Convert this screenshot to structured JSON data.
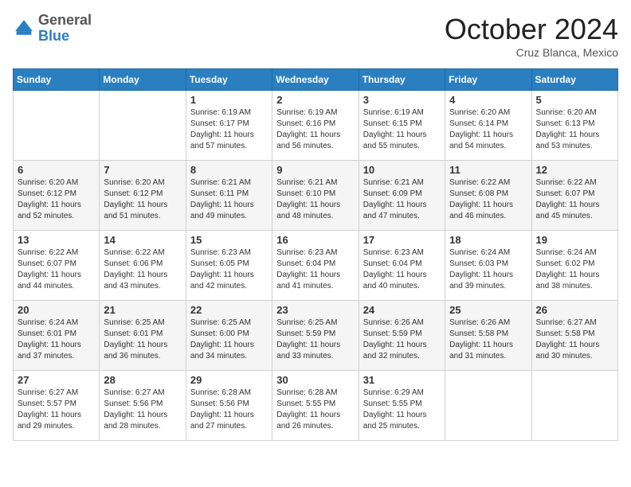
{
  "header": {
    "logo": {
      "general": "General",
      "blue": "Blue"
    },
    "title": "October 2024",
    "location": "Cruz Blanca, Mexico"
  },
  "days_of_week": [
    "Sunday",
    "Monday",
    "Tuesday",
    "Wednesday",
    "Thursday",
    "Friday",
    "Saturday"
  ],
  "weeks": [
    [
      null,
      null,
      {
        "num": "1",
        "sunrise": "Sunrise: 6:19 AM",
        "sunset": "Sunset: 6:17 PM",
        "daylight": "Daylight: 11 hours and 57 minutes."
      },
      {
        "num": "2",
        "sunrise": "Sunrise: 6:19 AM",
        "sunset": "Sunset: 6:16 PM",
        "daylight": "Daylight: 11 hours and 56 minutes."
      },
      {
        "num": "3",
        "sunrise": "Sunrise: 6:19 AM",
        "sunset": "Sunset: 6:15 PM",
        "daylight": "Daylight: 11 hours and 55 minutes."
      },
      {
        "num": "4",
        "sunrise": "Sunrise: 6:20 AM",
        "sunset": "Sunset: 6:14 PM",
        "daylight": "Daylight: 11 hours and 54 minutes."
      },
      {
        "num": "5",
        "sunrise": "Sunrise: 6:20 AM",
        "sunset": "Sunset: 6:13 PM",
        "daylight": "Daylight: 11 hours and 53 minutes."
      }
    ],
    [
      {
        "num": "6",
        "sunrise": "Sunrise: 6:20 AM",
        "sunset": "Sunset: 6:12 PM",
        "daylight": "Daylight: 11 hours and 52 minutes."
      },
      {
        "num": "7",
        "sunrise": "Sunrise: 6:20 AM",
        "sunset": "Sunset: 6:12 PM",
        "daylight": "Daylight: 11 hours and 51 minutes."
      },
      {
        "num": "8",
        "sunrise": "Sunrise: 6:21 AM",
        "sunset": "Sunset: 6:11 PM",
        "daylight": "Daylight: 11 hours and 49 minutes."
      },
      {
        "num": "9",
        "sunrise": "Sunrise: 6:21 AM",
        "sunset": "Sunset: 6:10 PM",
        "daylight": "Daylight: 11 hours and 48 minutes."
      },
      {
        "num": "10",
        "sunrise": "Sunrise: 6:21 AM",
        "sunset": "Sunset: 6:09 PM",
        "daylight": "Daylight: 11 hours and 47 minutes."
      },
      {
        "num": "11",
        "sunrise": "Sunrise: 6:22 AM",
        "sunset": "Sunset: 6:08 PM",
        "daylight": "Daylight: 11 hours and 46 minutes."
      },
      {
        "num": "12",
        "sunrise": "Sunrise: 6:22 AM",
        "sunset": "Sunset: 6:07 PM",
        "daylight": "Daylight: 11 hours and 45 minutes."
      }
    ],
    [
      {
        "num": "13",
        "sunrise": "Sunrise: 6:22 AM",
        "sunset": "Sunset: 6:07 PM",
        "daylight": "Daylight: 11 hours and 44 minutes."
      },
      {
        "num": "14",
        "sunrise": "Sunrise: 6:22 AM",
        "sunset": "Sunset: 6:06 PM",
        "daylight": "Daylight: 11 hours and 43 minutes."
      },
      {
        "num": "15",
        "sunrise": "Sunrise: 6:23 AM",
        "sunset": "Sunset: 6:05 PM",
        "daylight": "Daylight: 11 hours and 42 minutes."
      },
      {
        "num": "16",
        "sunrise": "Sunrise: 6:23 AM",
        "sunset": "Sunset: 6:04 PM",
        "daylight": "Daylight: 11 hours and 41 minutes."
      },
      {
        "num": "17",
        "sunrise": "Sunrise: 6:23 AM",
        "sunset": "Sunset: 6:04 PM",
        "daylight": "Daylight: 11 hours and 40 minutes."
      },
      {
        "num": "18",
        "sunrise": "Sunrise: 6:24 AM",
        "sunset": "Sunset: 6:03 PM",
        "daylight": "Daylight: 11 hours and 39 minutes."
      },
      {
        "num": "19",
        "sunrise": "Sunrise: 6:24 AM",
        "sunset": "Sunset: 6:02 PM",
        "daylight": "Daylight: 11 hours and 38 minutes."
      }
    ],
    [
      {
        "num": "20",
        "sunrise": "Sunrise: 6:24 AM",
        "sunset": "Sunset: 6:01 PM",
        "daylight": "Daylight: 11 hours and 37 minutes."
      },
      {
        "num": "21",
        "sunrise": "Sunrise: 6:25 AM",
        "sunset": "Sunset: 6:01 PM",
        "daylight": "Daylight: 11 hours and 36 minutes."
      },
      {
        "num": "22",
        "sunrise": "Sunrise: 6:25 AM",
        "sunset": "Sunset: 6:00 PM",
        "daylight": "Daylight: 11 hours and 34 minutes."
      },
      {
        "num": "23",
        "sunrise": "Sunrise: 6:25 AM",
        "sunset": "Sunset: 5:59 PM",
        "daylight": "Daylight: 11 hours and 33 minutes."
      },
      {
        "num": "24",
        "sunrise": "Sunrise: 6:26 AM",
        "sunset": "Sunset: 5:59 PM",
        "daylight": "Daylight: 11 hours and 32 minutes."
      },
      {
        "num": "25",
        "sunrise": "Sunrise: 6:26 AM",
        "sunset": "Sunset: 5:58 PM",
        "daylight": "Daylight: 11 hours and 31 minutes."
      },
      {
        "num": "26",
        "sunrise": "Sunrise: 6:27 AM",
        "sunset": "Sunset: 5:58 PM",
        "daylight": "Daylight: 11 hours and 30 minutes."
      }
    ],
    [
      {
        "num": "27",
        "sunrise": "Sunrise: 6:27 AM",
        "sunset": "Sunset: 5:57 PM",
        "daylight": "Daylight: 11 hours and 29 minutes."
      },
      {
        "num": "28",
        "sunrise": "Sunrise: 6:27 AM",
        "sunset": "Sunset: 5:56 PM",
        "daylight": "Daylight: 11 hours and 28 minutes."
      },
      {
        "num": "29",
        "sunrise": "Sunrise: 6:28 AM",
        "sunset": "Sunset: 5:56 PM",
        "daylight": "Daylight: 11 hours and 27 minutes."
      },
      {
        "num": "30",
        "sunrise": "Sunrise: 6:28 AM",
        "sunset": "Sunset: 5:55 PM",
        "daylight": "Daylight: 11 hours and 26 minutes."
      },
      {
        "num": "31",
        "sunrise": "Sunrise: 6:29 AM",
        "sunset": "Sunset: 5:55 PM",
        "daylight": "Daylight: 11 hours and 25 minutes."
      },
      null,
      null
    ]
  ]
}
